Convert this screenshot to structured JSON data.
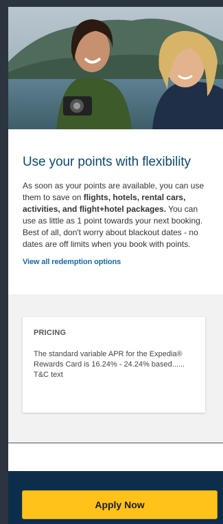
{
  "hero": {
    "image": "two-women-laughing-travel-photo"
  },
  "content": {
    "title": "Use your points with flexibility",
    "body_part1": "As soon as your points are available, you can use them to save on ",
    "body_bold": "flights, hotels, rental cars, activities, and flight+hotel packages.",
    "body_part2": " You can use as little as 1 point towards your next booking. Best of all, don't worry about blackout dates - no dates are off limits when you book with points.",
    "link_label": "View all redemption options"
  },
  "pricing": {
    "heading": "PRICING",
    "text": "The standard variable APR for the Expedia® Rewards Card is 16.24% - 24.24% based......",
    "tc": "T&C text"
  },
  "footer": {
    "apply_label": "Apply Now"
  },
  "colors": {
    "title": "#0a4a6e",
    "link": "#1768a6",
    "button": "#ffc21a",
    "footer": "#0d2e4a"
  }
}
